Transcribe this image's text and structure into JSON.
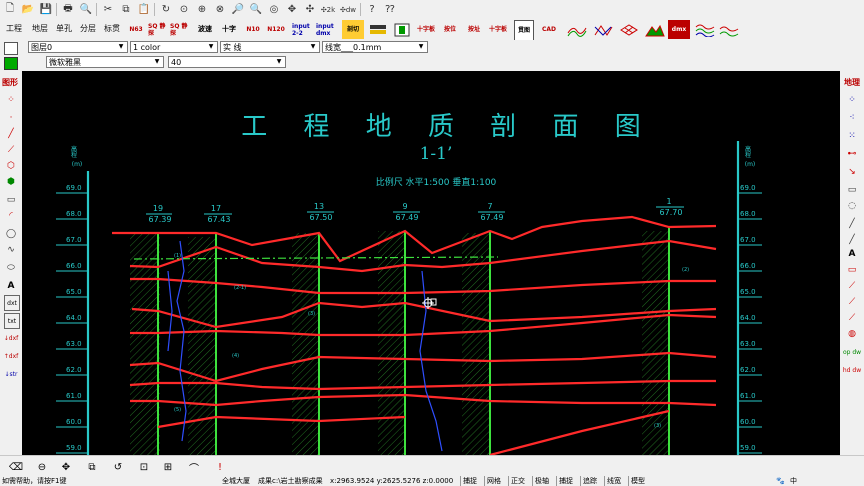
{
  "menu": {
    "items": [
      "工程",
      "地层",
      "单孔",
      "分层",
      "标贯"
    ]
  },
  "toolbar2": {
    "buttons": [
      "N63",
      "SQ 静探",
      "SQ 静探",
      "波速",
      "十字",
      "N10",
      "N120",
      "input 2-2",
      "input dmx",
      "剖切",
      "十字板",
      "按位",
      "按址",
      "十字板",
      "贯图",
      "CAD",
      "",
      "",
      "",
      "dmx",
      ""
    ]
  },
  "layer_bar": {
    "layer_value": "图层0",
    "color_value": "1 color",
    "linetype_value": "实        线",
    "linewidth_value": "线宽___0.1mm"
  },
  "font_bar": {
    "font_value": "微软雅黑",
    "size_value": "40"
  },
  "left_panel": {
    "title": "图形"
  },
  "right_panel": {
    "title": "地理"
  },
  "drawing": {
    "title": "工  程  地  质  剖  面  图",
    "section": "1-1’",
    "scale": "比例尺  水平1:500  垂直1:100",
    "elev_ticks": [
      "69.0",
      "68.0",
      "67.0",
      "66.0",
      "65.0",
      "64.0",
      "63.0",
      "62.0",
      "61.0",
      "60.0",
      "59.0"
    ],
    "axis_unit": "(m)",
    "boreholes": [
      {
        "id": "19",
        "elev": "67.39"
      },
      {
        "id": "17",
        "elev": "67.43"
      },
      {
        "id": "13",
        "elev": "67.50"
      },
      {
        "id": "9",
        "elev": "67.49"
      },
      {
        "id": "7",
        "elev": "67.49"
      },
      {
        "id": "1",
        "elev": "67.70"
      }
    ]
  },
  "status": {
    "left": "如需帮助，请按F1键",
    "coords": "x:2963.9524 y:2625.5276 z:0.0000",
    "path": "成果c:\\岩土勘察成果",
    "mode": "全城大厦",
    "buttons": [
      "捕捉",
      "网格",
      "正交",
      "极轴",
      "捕捉",
      "追踪",
      "线宽",
      "模型"
    ]
  },
  "taskbar_right": "中"
}
